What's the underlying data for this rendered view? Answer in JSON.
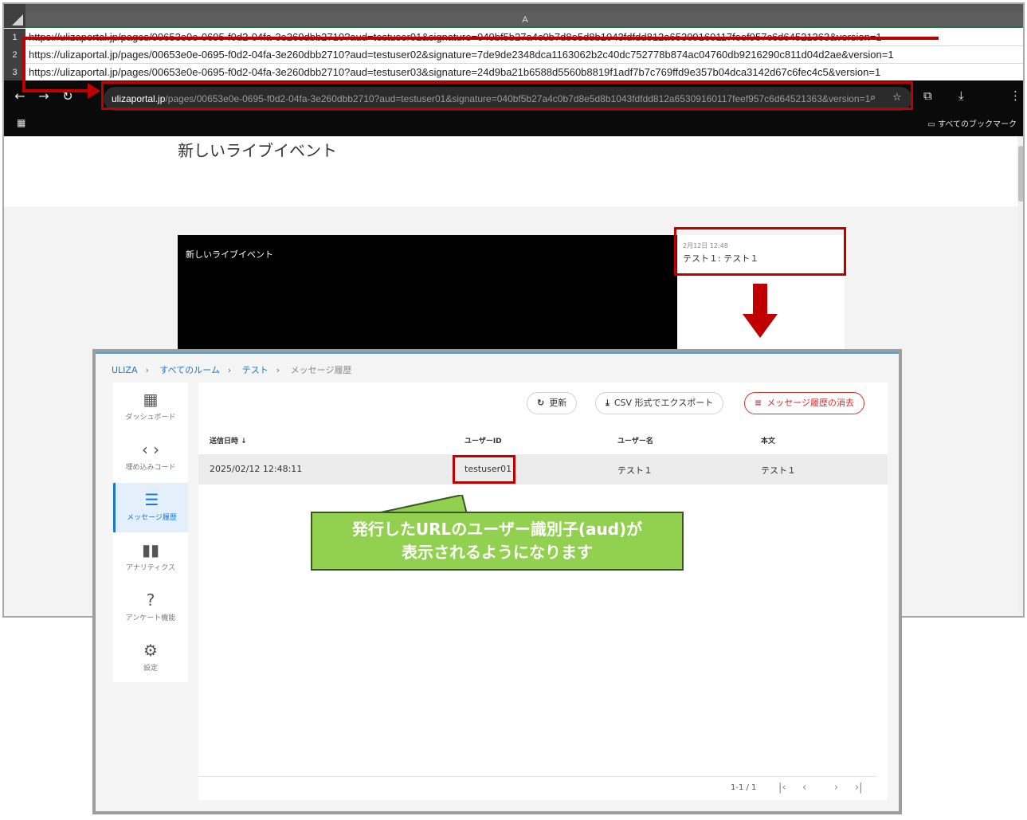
{
  "spreadsheet": {
    "column_header": "A",
    "rows": [
      {
        "num": "1",
        "url": "https://ulizaportal.jp/pages/00653e0e-0695-f0d2-04fa-3e260dbb2710?aud=testuser01&signature=040bf5b27a4c0b7d8e5d8b1043fdfdd812a65309160117feef957c6d64521363&version=1"
      },
      {
        "num": "2",
        "url": "https://ulizaportal.jp/pages/00653e0e-0695-f0d2-04fa-3e260dbb2710?aud=testuser02&signature=7de9de2348dca1163062b2c40dc752778b874ac04760db9216290c811d04d2ae&version=1"
      },
      {
        "num": "3",
        "url": "https://ulizaportal.jp/pages/00653e0e-0695-f0d2-04fa-3e260dbb2710?aud=testuser03&signature=24d9ba21b6588d5560b8819f1adf7b7c769ffd9e357b04dca3142d67c6fec4c5&version=1"
      }
    ]
  },
  "browser": {
    "host": "ulizaportal.jp",
    "path": "/pages/00653e0e-0695-f0d2-04fa-3e260dbb2710?aud=testuser01&signature=040bf5b27a4c0b7d8e5d8b1043fdfdd812a65309160117feef957c6d64521363&version=1",
    "bookmarks_label": "すべてのブックマーク"
  },
  "event_page": {
    "title": "新しいライブイベント",
    "video_title": "新しいライブイベント",
    "chat_time": "2月12日 12:48",
    "chat_message": "テスト１: テスト１"
  },
  "admin": {
    "breadcrumb": [
      "ULIZA",
      "すべてのルーム",
      "テスト",
      "メッセージ履歴"
    ],
    "sidebar": [
      {
        "label": "ダッシュボード",
        "icon": "dashboard-icon"
      },
      {
        "label": "埋め込みコード",
        "icon": "code-icon"
      },
      {
        "label": "メッセージ履歴",
        "icon": "message-icon"
      },
      {
        "label": "アナリティクス",
        "icon": "analytics-icon"
      },
      {
        "label": "アンケート機能",
        "icon": "question-icon"
      },
      {
        "label": "設定",
        "icon": "gear-icon"
      }
    ],
    "toolbar": {
      "refresh_label": "更新",
      "export_label": "CSV 形式でエクスポート",
      "clear_label": "メッセージ履歴の消去"
    },
    "table": {
      "headers": {
        "sent_at": "送信日時",
        "user_id": "ユーザーID",
        "user_name": "ユーザー名",
        "body": "本文"
      },
      "rows": [
        {
          "sent_at": "2025/02/12 12:48:11",
          "user_id": "testuser01",
          "user_name": "テスト１",
          "body": "テスト１"
        }
      ]
    },
    "pagination": {
      "range": "1-1 / 1"
    }
  },
  "callout": {
    "line1": "発行したURLのユーザー識別子(aud)が",
    "line2": "表示されるようになります"
  },
  "colors": {
    "annotation_red": "#c00000",
    "callout_green": "#92d050",
    "accent_blue": "#1976d2"
  }
}
